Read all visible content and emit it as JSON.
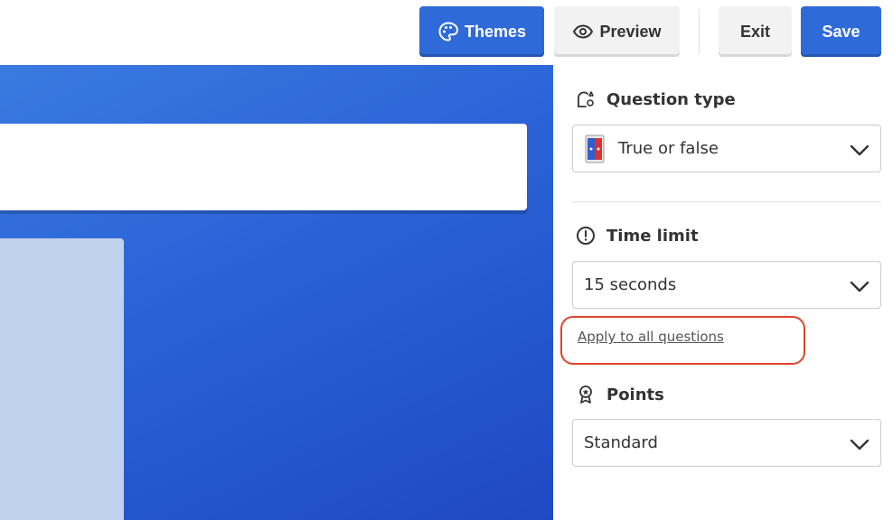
{
  "toolbar": {
    "themes_label": "Themes",
    "preview_label": "Preview",
    "exit_label": "Exit",
    "save_label": "Save"
  },
  "panel": {
    "question_type": {
      "title": "Question type",
      "value": "True or false"
    },
    "time_limit": {
      "title": "Time limit",
      "value": "15 seconds",
      "apply_link": "Apply to all questions"
    },
    "points": {
      "title": "Points",
      "value": "Standard"
    }
  },
  "colors": {
    "primary": "#2f6ad9",
    "canvas_start": "#3a7ae0",
    "canvas_end": "#1e49c4",
    "highlight": "#e0442b"
  },
  "icons": {
    "themes": "palette-icon",
    "preview": "eye-icon",
    "question_type": "shapes-icon",
    "true_false": "true-false-icon",
    "time_limit": "clock-icon",
    "points": "award-icon",
    "dropdown": "chevron-down-icon"
  }
}
